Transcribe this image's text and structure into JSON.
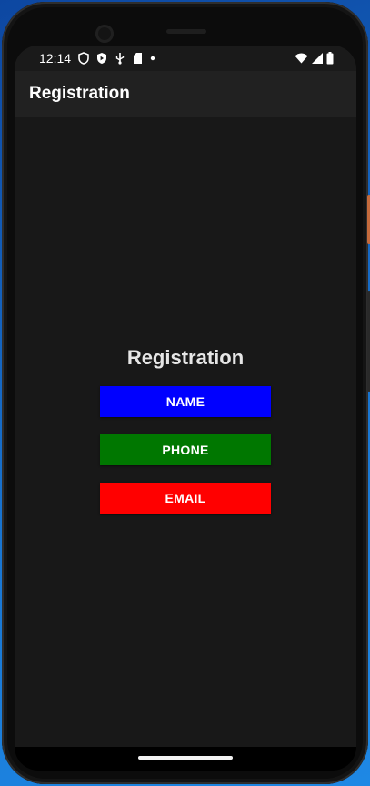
{
  "status_bar": {
    "time": "12:14",
    "left_icons": [
      "privacy-shield-icon",
      "play-protect-icon",
      "usb-debug-icon",
      "sd-card-icon",
      "dot-icon"
    ],
    "right_icons": [
      "wifi-icon",
      "cellular-signal-icon",
      "battery-icon"
    ]
  },
  "app_bar": {
    "title": "Registration"
  },
  "main": {
    "heading": "Registration",
    "buttons": [
      {
        "label": "NAME",
        "color": "#0000ff"
      },
      {
        "label": "PHONE",
        "color": "#007700"
      },
      {
        "label": "EMAIL",
        "color": "#ff0000"
      }
    ]
  },
  "colors": {
    "screen_background": "#181818",
    "app_bar_background": "#212121",
    "heading_text": "#e6e6e6"
  }
}
